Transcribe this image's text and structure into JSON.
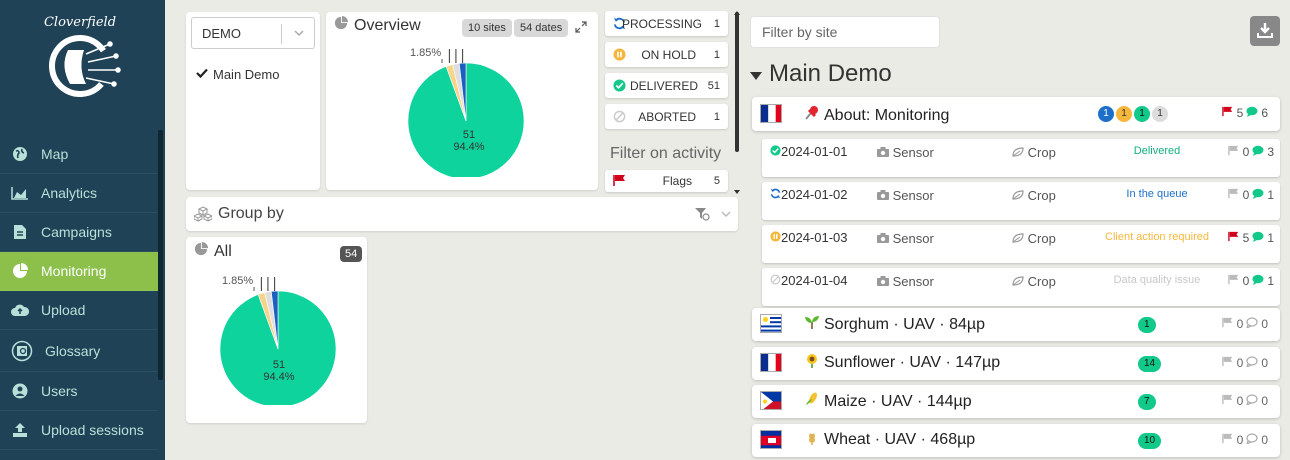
{
  "sidebar": {
    "logo_text": "Cloverfield",
    "items": [
      {
        "label": "Map",
        "icon": "globe-icon"
      },
      {
        "label": "Analytics",
        "icon": "area-chart-icon"
      },
      {
        "label": "Campaigns",
        "icon": "document-icon"
      },
      {
        "label": "Monitoring",
        "icon": "pie-chart-icon",
        "active": true
      },
      {
        "label": "Upload",
        "icon": "cloud-upload-icon"
      },
      {
        "label": "Glossary",
        "icon": "glossary-icon"
      },
      {
        "label": "Users",
        "icon": "user-circle-icon"
      },
      {
        "label": "Upload sessions",
        "icon": "upload-icon"
      }
    ]
  },
  "demo_select": {
    "value": "DEMO",
    "checked_item": "Main Demo"
  },
  "overview": {
    "title": "Overview",
    "sites_badge": "10 sites",
    "dates_badge": "54 dates",
    "slice_small_label": "1.85%",
    "slice_big_count": "51",
    "slice_big_pct": "94.4%"
  },
  "chart_data": [
    {
      "type": "pie",
      "title": "Overview",
      "slices": [
        {
          "label": "Delivered",
          "count": 51,
          "pct": 94.4,
          "color": "#0fd39c"
        },
        {
          "label": "On hold",
          "count": 1,
          "pct": 1.85,
          "color": "#f8d38a"
        },
        {
          "label": "Aborted",
          "count": 1,
          "pct": 1.85,
          "color": "#dedede"
        },
        {
          "label": "Processing",
          "count": 1,
          "pct": 1.85,
          "color": "#1b5fbf"
        }
      ]
    },
    {
      "type": "pie",
      "title": "All",
      "slices": [
        {
          "label": "Delivered",
          "count": 51,
          "pct": 94.4,
          "color": "#0fd39c"
        },
        {
          "label": "On hold",
          "count": 1,
          "pct": 1.85,
          "color": "#f8d38a"
        },
        {
          "label": "Aborted",
          "count": 1,
          "pct": 1.85,
          "color": "#dedede"
        },
        {
          "label": "Processing",
          "count": 1,
          "pct": 1.85,
          "color": "#1b5fbf"
        }
      ]
    }
  ],
  "status_filters": [
    {
      "label": "PROCESSING",
      "count": "1",
      "icon": "refresh-icon",
      "color": "#1e6fc9"
    },
    {
      "label": "ON HOLD",
      "count": "1",
      "icon": "pause-circle-icon",
      "color": "#f5b73b"
    },
    {
      "label": "DELIVERED",
      "count": "51",
      "icon": "check-circle-icon",
      "color": "#13c98a"
    },
    {
      "label": "ABORTED",
      "count": "1",
      "icon": "ban-icon",
      "color": "#c8c8c8"
    }
  ],
  "activity": {
    "title": "Filter on activity",
    "flags_label": "Flags",
    "flags_count": "5"
  },
  "groupby": {
    "label": "Group by"
  },
  "all_panel": {
    "title": "All",
    "badge": "54",
    "slice_small_label": "1.85%",
    "slice_big_count": "51",
    "slice_big_pct": "94.4%"
  },
  "right": {
    "filter_placeholder": "Filter by site",
    "group_title": "Main Demo",
    "monitoring_card": {
      "title": "About: Monitoring",
      "counts": [
        "1",
        "1",
        "1",
        "1"
      ],
      "flags": "5",
      "comments": "6"
    },
    "rows": [
      {
        "date": "2024-01-01",
        "sensor": "Sensor",
        "crop": "Crop",
        "status": "Delivered",
        "status_color": "#13b07a",
        "flags": "0",
        "comments": "3",
        "icon": "check-circle-icon",
        "icon_color": "#13c98a",
        "flag_red": false
      },
      {
        "date": "2024-01-02",
        "sensor": "Sensor",
        "crop": "Crop",
        "status": "In the queue",
        "status_color": "#1e6fc9",
        "flags": "0",
        "comments": "1",
        "icon": "refresh-icon",
        "icon_color": "#1e6fc9",
        "flag_red": false
      },
      {
        "date": "2024-01-03",
        "sensor": "Sensor",
        "crop": "Crop",
        "status": "Client action required",
        "status_color": "#f5b73b",
        "flags": "5",
        "comments": "1",
        "icon": "pause-circle-icon",
        "icon_color": "#f5b73b",
        "flag_red": true
      },
      {
        "date": "2024-01-04",
        "sensor": "Sensor",
        "crop": "Crop",
        "status": "Data quality issue",
        "status_color": "#c8c8c8",
        "flags": "0",
        "comments": "1",
        "icon": "ban-icon",
        "icon_color": "#c8c8c8",
        "flag_red": false
      }
    ],
    "sites": [
      {
        "title": "Sorghum · UAV · 84µp",
        "count": "1",
        "flags": "0",
        "comments": "0",
        "flag": "uruguay-flag",
        "crop_icon": "seedling-icon"
      },
      {
        "title": "Sunflower · UAV · 147µp",
        "count": "14",
        "flags": "0",
        "comments": "0",
        "flag": "france-flag",
        "crop_icon": "sunflower-icon"
      },
      {
        "title": "Maize · UAV · 144µp",
        "count": "7",
        "flags": "0",
        "comments": "0",
        "flag": "philippines-flag",
        "crop_icon": "corn-icon"
      },
      {
        "title": "Wheat · UAV · 468µp",
        "count": "10",
        "flags": "0",
        "comments": "0",
        "flag": "cambodia-flag",
        "crop_icon": "wheat-icon"
      }
    ]
  }
}
